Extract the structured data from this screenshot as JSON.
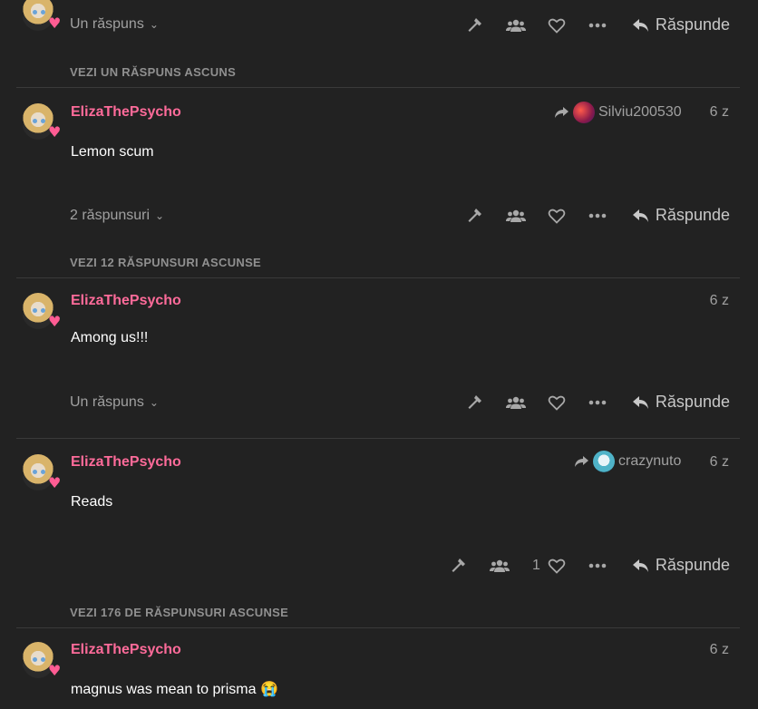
{
  "comments": [
    {
      "replies_label": "Un răspuns",
      "reply_label": "Răspunde"
    },
    {
      "username": "ElizaThePsycho",
      "reply_to": "Silviu200530",
      "time": "6 z",
      "text": "Lemon scum",
      "replies_label": "2 răspunsuri",
      "reply_label": "Răspunde"
    },
    {
      "username": "ElizaThePsycho",
      "time": "6 z",
      "text": "Among us!!!",
      "replies_label": "Un răspuns",
      "reply_label": "Răspunde"
    },
    {
      "username": "ElizaThePsycho",
      "reply_to": "crazynuto",
      "time": "6 z",
      "text": "Reads",
      "like_count": "1",
      "reply_label": "Răspunde"
    },
    {
      "username": "ElizaThePsycho",
      "time": "6 z",
      "text": "magnus was mean to prisma 😭"
    }
  ],
  "hidden_links": [
    "VEZI UN RĂSPUNS ASCUNS",
    "VEZI 12 RĂSPUNSURI ASCUNSE",
    "VEZI 176 DE RĂSPUNSURI ASCUNSE"
  ],
  "colors": {
    "background": "#222222",
    "username": "#ff6b9a",
    "muted": "#a0a0a0"
  },
  "icons": [
    "hammer-icon",
    "group-icon",
    "heart-icon",
    "more-icon",
    "reply-icon",
    "share-arrow-icon",
    "chevron-down-icon"
  ]
}
